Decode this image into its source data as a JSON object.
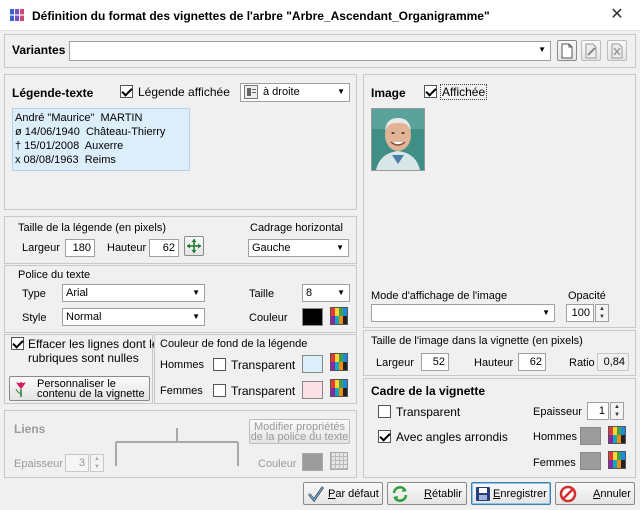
{
  "window": {
    "title": "Définition du format des vignettes de l'arbre \"Arbre_Ascendant_Organigramme\"",
    "close_glyph": "✕"
  },
  "variantes": {
    "label": "Variantes",
    "value": ""
  },
  "legende": {
    "title": "Légende-texte",
    "checkbox_label": "Légende affichée",
    "checked": true,
    "position_value": "à droite",
    "lines": [
      "André \"Maurice\"  MARTIN",
      "ø 14/06/1940  Château-Thierry",
      "† 15/01/2008  Auxerre",
      "x 08/08/1963  Reims"
    ],
    "bg_color": "#ddeefb"
  },
  "taille_legende": {
    "title": "Taille de la légende (en pixels)",
    "largeur_label": "Largeur",
    "largeur_value": "180",
    "hauteur_label": "Hauteur",
    "hauteur_value": "62",
    "cadrage_label": "Cadrage horizontal",
    "cadrage_value": "Gauche"
  },
  "police": {
    "title": "Police du texte",
    "type_label": "Type",
    "type_value": "Arial",
    "taille_label": "Taille",
    "taille_value": "8",
    "style_label": "Style",
    "style_value": "Normal",
    "couleur_label": "Couleur",
    "couleur": "#000000"
  },
  "effacer": {
    "label_line1": "Effacer les lignes dont les",
    "label_line2": "rubriques sont nulles",
    "checked": true
  },
  "personnaliser": {
    "line1": "Personnaliser le",
    "line2": "contenu de la vignette"
  },
  "fond": {
    "title": "Couleur de fond de la légende",
    "hommes_label": "Hommes",
    "femmes_label": "Femmes",
    "transparent_label": "Transparent",
    "hommes_color": "#ddeefb",
    "femmes_color": "#fde0e6"
  },
  "liens": {
    "title": "Liens",
    "epaisseur_label": "Epaisseur",
    "epaisseur_value": "3",
    "couleur_label": "Couleur",
    "couleur": "#9c9c9c",
    "modifier_line1": "Modifier propriétés",
    "modifier_line2": "de la police du texte"
  },
  "image": {
    "title": "Image",
    "checkbox_label": "Affichée",
    "checked": true,
    "mode_label": "Mode d'affichage de l'image",
    "mode_value": "",
    "opacite_label": "Opacité",
    "opacite_value": "100"
  },
  "taille_image": {
    "title": "Taille de l'image dans la vignette (en pixels)",
    "largeur_label": "Largeur",
    "largeur_value": "52",
    "hauteur_label": "Hauteur",
    "hauteur_value": "62",
    "ratio_label": "Ratio",
    "ratio_value": "0,84"
  },
  "cadre": {
    "title": "Cadre de la vignette",
    "transparent_label": "Transparent",
    "transparent_checked": false,
    "epaisseur_label": "Epaisseur",
    "epaisseur_value": "1",
    "angles_label": "Avec angles arrondis",
    "angles_checked": true,
    "hommes_label": "Hommes",
    "femmes_label": "Femmes",
    "hommes_color": "#9c9c9c",
    "femmes_color": "#9c9c9c"
  },
  "footer": {
    "par_defaut": "Par défaut",
    "retablir": "Rétablir",
    "enregistrer": "Enregistrer",
    "annuler": "Annuler"
  }
}
